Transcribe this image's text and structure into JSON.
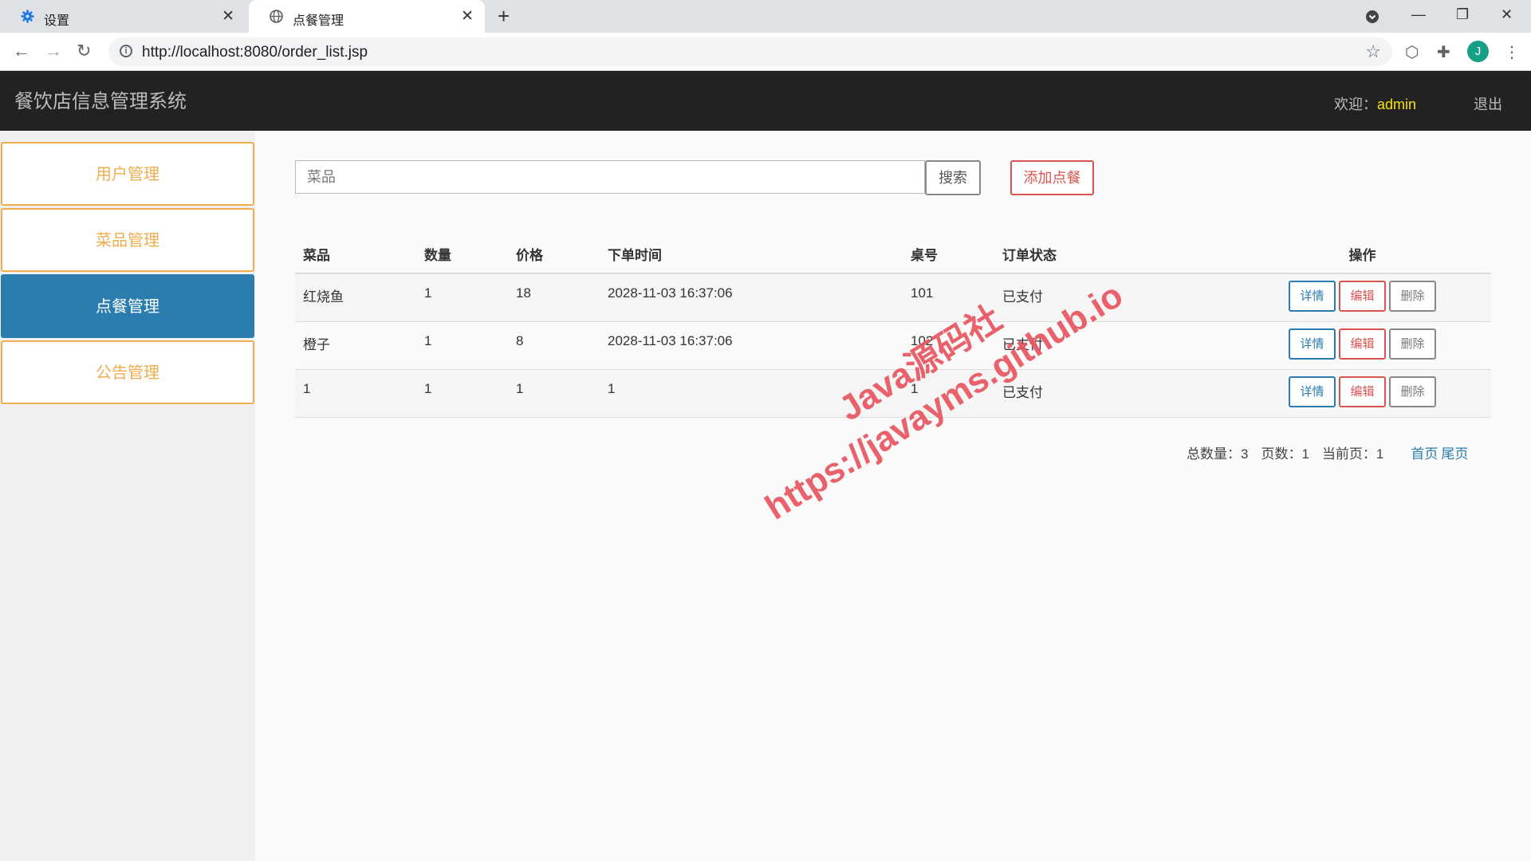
{
  "browser": {
    "tabs": [
      {
        "title": "设置",
        "icon": "gear-icon",
        "active": false
      },
      {
        "title": "点餐管理",
        "icon": "globe-icon",
        "active": true
      }
    ],
    "url": "http://localhost:8080/order_list.jsp",
    "profile_initial": "J"
  },
  "header": {
    "brand": "餐饮店信息管理系统",
    "welcome_label": "欢迎：",
    "username": "admin",
    "logout": "退出"
  },
  "sidebar": {
    "items": [
      {
        "label": "用户管理",
        "active": false
      },
      {
        "label": "菜品管理",
        "active": false
      },
      {
        "label": "点餐管理",
        "active": true
      },
      {
        "label": "公告管理",
        "active": false
      }
    ]
  },
  "toolbar": {
    "search_placeholder": "菜品",
    "search_button": "搜索",
    "add_button": "添加点餐"
  },
  "table": {
    "columns": [
      "菜品",
      "数量",
      "价格",
      "下单时间",
      "桌号",
      "订单状态",
      "操作"
    ],
    "rows": [
      {
        "dish": "红烧鱼",
        "qty": "1",
        "price": "18",
        "time": "2028-11-03 16:37:06",
        "table": "101",
        "status": "已支付"
      },
      {
        "dish": "橙子",
        "qty": "1",
        "price": "8",
        "time": "2028-11-03 16:37:06",
        "table": "102",
        "status": "已支付"
      },
      {
        "dish": "1",
        "qty": "1",
        "price": "1",
        "time": "1",
        "table": "1",
        "status": "已支付"
      }
    ],
    "actions": {
      "detail": "详情",
      "edit": "编辑",
      "delete": "删除"
    }
  },
  "pagination": {
    "total_label": "总数量：3",
    "pages_label": "页数：1",
    "current_label": "当前页：1",
    "first": "首页",
    "last": "尾页"
  },
  "watermark": {
    "line1": "Java源码社",
    "line2": "https://javayms.github.io"
  }
}
